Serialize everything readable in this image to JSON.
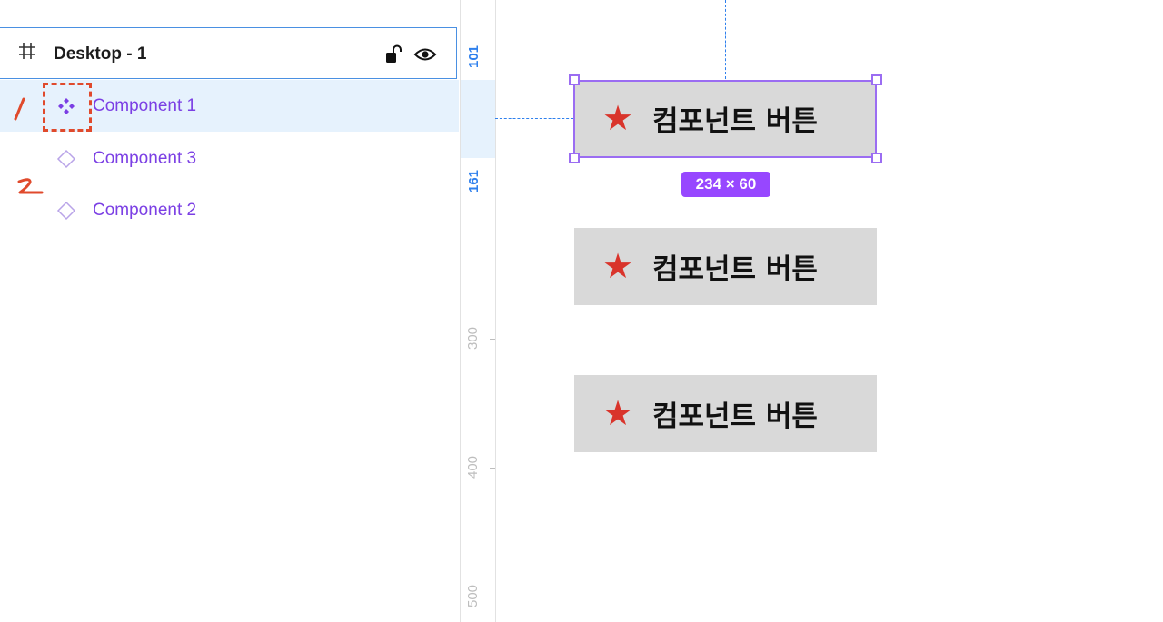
{
  "layers": {
    "frame": {
      "title": "Desktop - 1",
      "icon": "frame-hash-icon",
      "lock_icon": "unlock-icon",
      "visibility_icon": "eye-icon"
    },
    "items": [
      {
        "label": "Component 1",
        "icon": "component-main-icon",
        "selected": true
      },
      {
        "label": "Component 3",
        "icon": "component-instance-icon",
        "selected": false
      },
      {
        "label": "Component 2",
        "icon": "component-instance-icon",
        "selected": false
      }
    ],
    "annotations": {
      "first": "/",
      "second": "2"
    }
  },
  "ruler": {
    "selection_start": "101",
    "selection_end": "161",
    "ticks": [
      "300",
      "400",
      "500"
    ]
  },
  "canvas": {
    "buttons": [
      {
        "star": "★",
        "label": "컴포넌트 버튼"
      },
      {
        "star": "★",
        "label": "컴포넌트 버튼"
      },
      {
        "star": "★",
        "label": "컴포넌트 버튼"
      }
    ],
    "selection_size": "234 × 60"
  },
  "colors": {
    "accent_purple": "#7b3fe4",
    "selection_purple": "#9747ff",
    "guide_blue": "#2f80ed",
    "selected_row_bg": "#e6f2fd",
    "star_red": "#d9342b",
    "annotation_red": "#e04a2c",
    "button_gray": "#d9d9d9"
  }
}
